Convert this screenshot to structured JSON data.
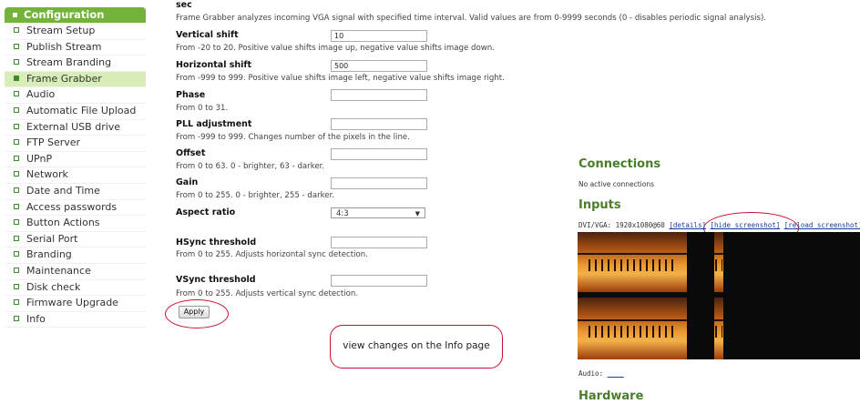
{
  "sidebar": {
    "header": "Configuration",
    "items": [
      {
        "label": "Stream Setup",
        "active": false
      },
      {
        "label": "Publish Stream",
        "active": false
      },
      {
        "label": "Stream Branding",
        "active": false
      },
      {
        "label": "Frame Grabber",
        "active": true
      },
      {
        "label": "Audio",
        "active": false
      },
      {
        "label": "Automatic File Upload",
        "active": false
      },
      {
        "label": "External USB drive",
        "active": false
      },
      {
        "label": "FTP Server",
        "active": false
      },
      {
        "label": "UPnP",
        "active": false
      },
      {
        "label": "Network",
        "active": false
      },
      {
        "label": "Date and Time",
        "active": false
      },
      {
        "label": "Access passwords",
        "active": false
      },
      {
        "label": "Button Actions",
        "active": false
      },
      {
        "label": "Serial Port",
        "active": false
      },
      {
        "label": "Branding",
        "active": false
      },
      {
        "label": "Maintenance",
        "active": false
      },
      {
        "label": "Disk check",
        "active": false
      },
      {
        "label": "Firmware Upgrade",
        "active": false
      },
      {
        "label": "Info",
        "active": false
      }
    ]
  },
  "form": {
    "top_unit": "sec",
    "top_hint": "Frame Grabber analyzes incoming VGA signal with specified time interval. Valid values are from 0-9999 seconds (0 - disables periodic signal analysis).",
    "vertical_shift": {
      "label": "Vertical shift",
      "value": "10",
      "hint": "From -20 to 20. Positive value shifts image up, negative value shifts image down."
    },
    "horizontal_shift": {
      "label": "Horizontal shift",
      "value": "500",
      "hint": "From -999 to 999. Positive value shifts image left, negative value shifts image right."
    },
    "phase": {
      "label": "Phase",
      "value": "",
      "hint": "From 0 to 31."
    },
    "pll": {
      "label": "PLL adjustment",
      "value": "",
      "hint": "From -999 to 999. Changes number of the pixels in the line."
    },
    "offset": {
      "label": "Offset",
      "value": "",
      "hint": "From 0 to 63. 0 - brighter, 63 - darker."
    },
    "gain": {
      "label": "Gain",
      "value": "",
      "hint": "From 0 to 255. 0 - brighter, 255 - darker."
    },
    "aspect_ratio": {
      "label": "Aspect ratio",
      "value": "4:3"
    },
    "hsync": {
      "label": "HSync threshold",
      "value": "",
      "hint": "From 0 to 255. Adjusts horizontal sync detection."
    },
    "vsync": {
      "label": "VSync threshold",
      "value": "",
      "hint": "From 0 to 255. Adjusts vertical sync detection."
    },
    "apply_label": "Apply"
  },
  "callout": "view changes on the Info page",
  "right": {
    "connections_title": "Connections",
    "connections_text": "No active connections",
    "inputs_title": "Inputs",
    "input_line": "DVI/VGA: 1920x1080@60",
    "details_link": "[details]",
    "hide_link": "[hide screenshot]",
    "reload_link": "[reload screenshot]",
    "audio_label": "Audio:",
    "audio_link": "____",
    "hardware_title": "Hardware"
  },
  "colors": {
    "accent_green": "#73b33a",
    "active_item_bg": "#d8edb8",
    "heading_green": "#4a7d2a",
    "annotation_red": "#c8102e"
  }
}
